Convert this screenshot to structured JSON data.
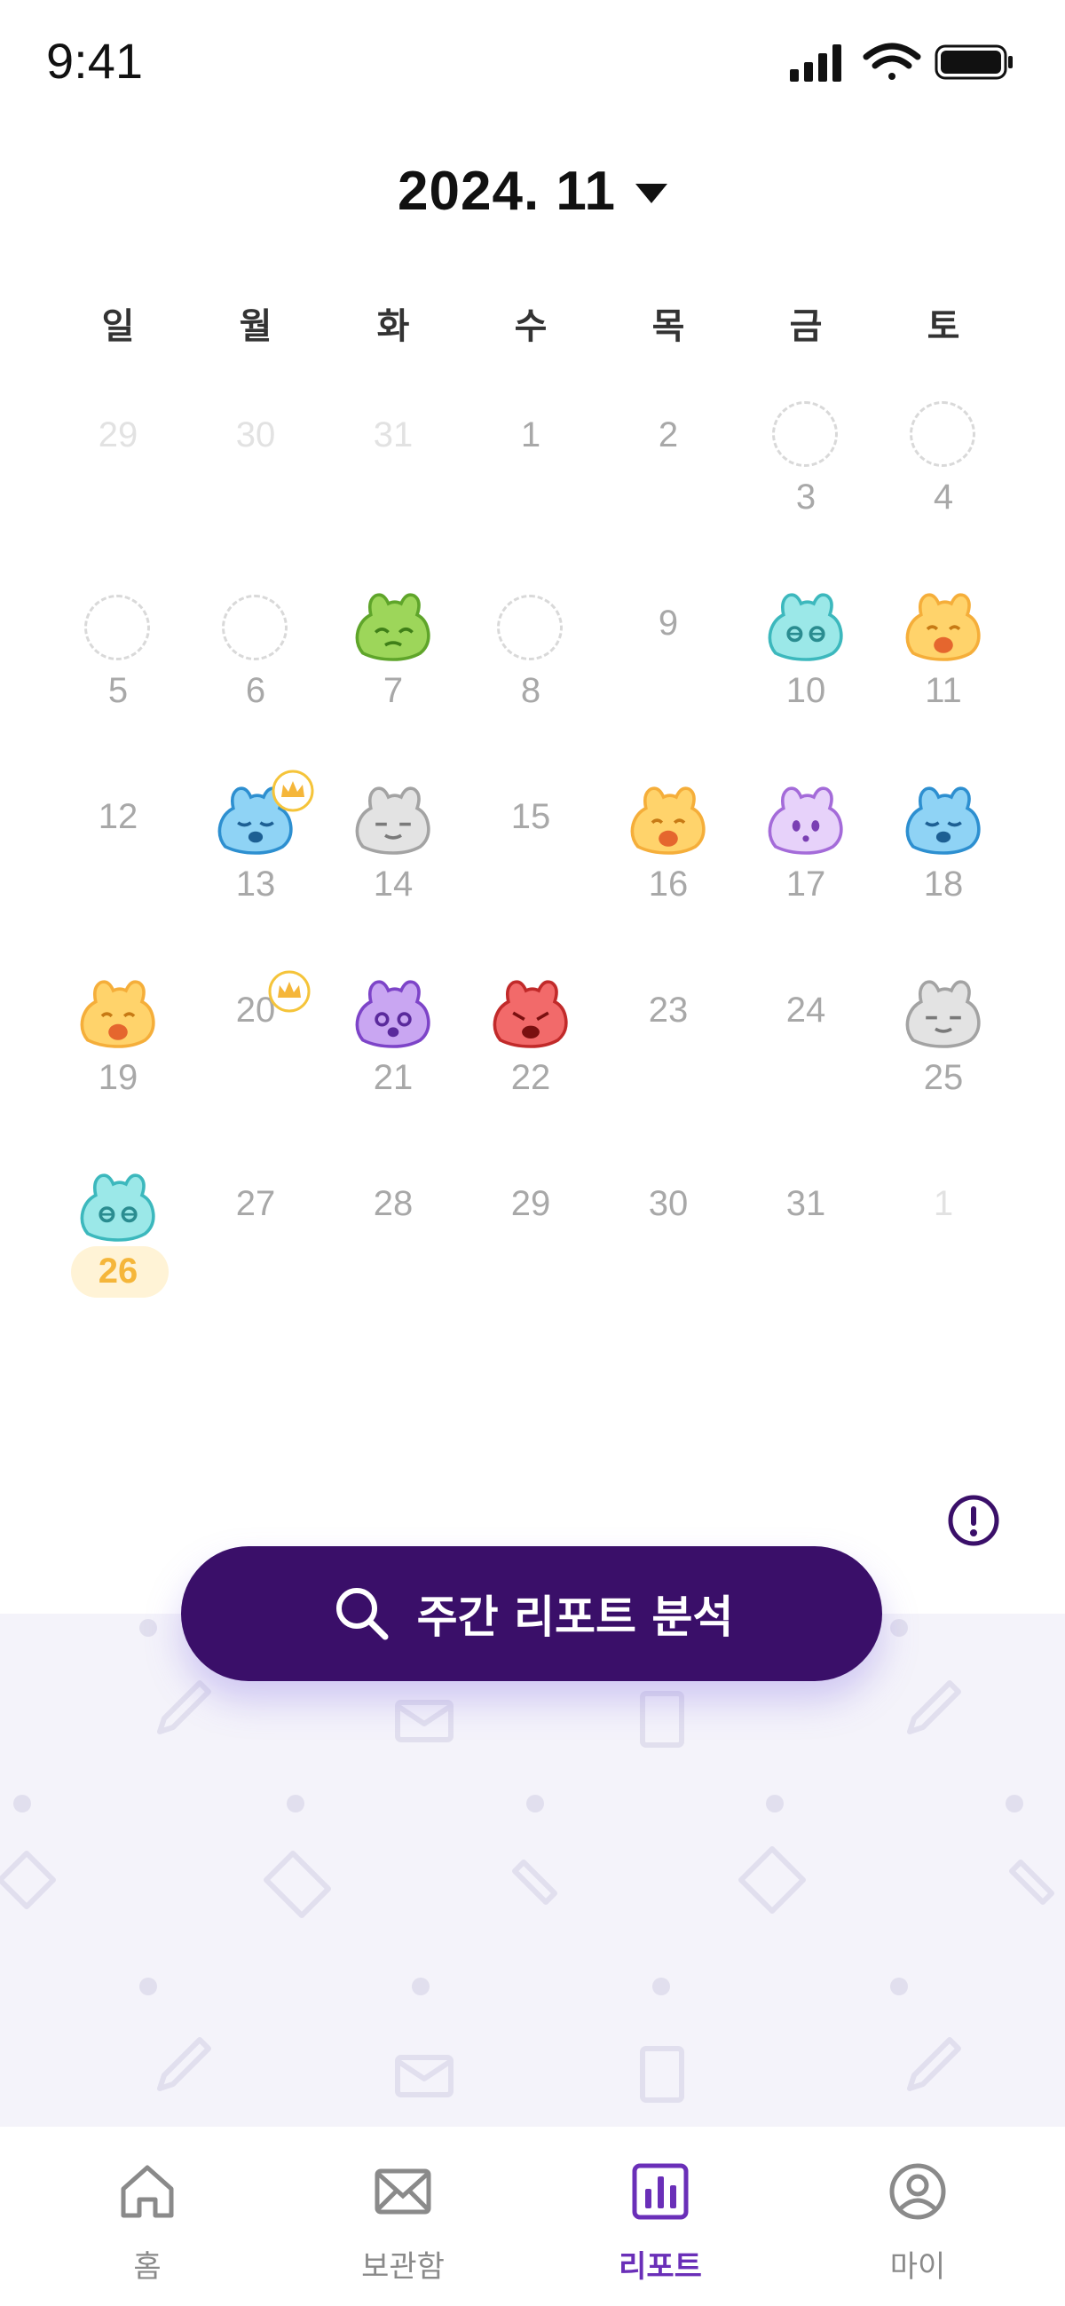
{
  "status_bar": {
    "time": "9:41"
  },
  "header": {
    "month_label": "2024. 11"
  },
  "weekdays": [
    "일",
    "월",
    "화",
    "수",
    "목",
    "금",
    "토"
  ],
  "calendar": {
    "week1": [
      "29",
      "30",
      "31",
      "1",
      "2",
      "3",
      "4"
    ],
    "week2": [
      "5",
      "6",
      "7",
      "8",
      "9",
      "10",
      "11"
    ],
    "week3": [
      "12",
      "13",
      "14",
      "15",
      "16",
      "17",
      "18"
    ],
    "week4": [
      "19",
      "20",
      "21",
      "22",
      "23",
      "24",
      "25"
    ],
    "week5": [
      "26",
      "27",
      "28",
      "29",
      "30",
      "31",
      "1"
    ]
  },
  "moods": {
    "d7": "green-sick-face",
    "d10": "teal-sleepy-face",
    "d11": "yellow-laughing-face",
    "d13": "blue-crying-face",
    "d14": "gray-calm-face",
    "d16": "yellow-laughing-face",
    "d17": "purple-surprised-face",
    "d18": "blue-crying-face",
    "d19": "yellow-laughing-face",
    "d21": "purple-worried-face",
    "d22": "red-angry-face",
    "d25": "gray-calm-face",
    "d26": "teal-sleepy-face"
  },
  "action": {
    "analysis_label": "주간 리포트 분석"
  },
  "nav": {
    "home": "홈",
    "inbox": "보관함",
    "report": "리포트",
    "my": "마이"
  },
  "colors": {
    "primary": "#3a0f69",
    "active_nav": "#6a2fb8",
    "today_highlight": "#f5b63a"
  }
}
